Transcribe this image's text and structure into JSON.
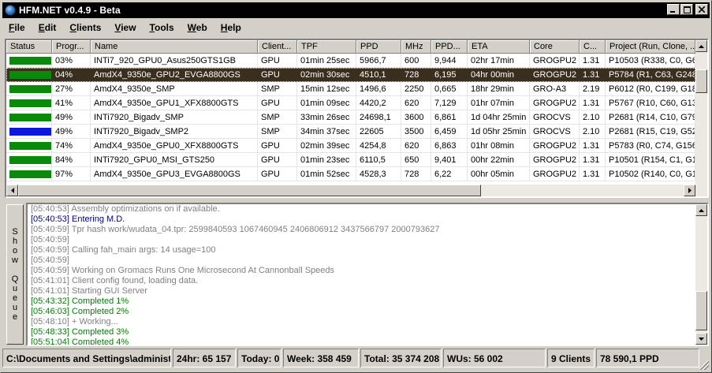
{
  "window": {
    "title": "HFM.NET v0.4.9 - Beta"
  },
  "menu": [
    {
      "first": "F",
      "rest": "ile"
    },
    {
      "first": "E",
      "rest": "dit"
    },
    {
      "first": "C",
      "rest": "lients"
    },
    {
      "first": "V",
      "rest": "iew"
    },
    {
      "first": "T",
      "rest": "ools"
    },
    {
      "first": "W",
      "rest": "eb"
    },
    {
      "first": "H",
      "rest": "elp"
    }
  ],
  "grid": {
    "columns": [
      "Status",
      "Progr...",
      "Name",
      "Client...",
      "TPF",
      "PPD",
      "MHz",
      "PPD...",
      "ETA",
      "Core",
      "C...",
      "Project (Run, Clone, ..."
    ],
    "rows": [
      {
        "status_color": "#0a8a0a",
        "progress": "03%",
        "name": "INTi7_920_GPU0_Asus250GTS1GB",
        "client": "GPU",
        "tpf": "01min 25sec",
        "ppd": "5966,7",
        "mhz": "600",
        "ppd_mhz": "9,944",
        "eta": "02hr 17min",
        "core": "GROGPU2",
        "cv": "1.31",
        "project": "P10503 (R338, C0, G6"
      },
      {
        "status_color": "#0a8a0a",
        "progress": "04%",
        "name": "AmdX4_9350e_GPU2_EVGA8800GS",
        "client": "GPU",
        "tpf": "02min 30sec",
        "ppd": "4510,1",
        "mhz": "728",
        "ppd_mhz": "6,195",
        "eta": "04hr 00min",
        "core": "GROGPU2",
        "cv": "1.31",
        "project": "P5784 (R1, C63, G248",
        "selected": true
      },
      {
        "status_color": "#0a8a0a",
        "progress": "27%",
        "name": "AmdX4_9350e_SMP",
        "client": "SMP",
        "tpf": "15min 12sec",
        "ppd": "1496,6",
        "mhz": "2250",
        "ppd_mhz": "0,665",
        "eta": "18hr 29min",
        "core": "GRO-A3",
        "cv": "2.19",
        "project": "P6012 (R0, C199, G18"
      },
      {
        "status_color": "#0a8a0a",
        "progress": "41%",
        "name": "AmdX4_9350e_GPU1_XFX8800GTS",
        "client": "GPU",
        "tpf": "01min 09sec",
        "ppd": "4420,2",
        "mhz": "620",
        "ppd_mhz": "7,129",
        "eta": "01hr 07min",
        "core": "GROGPU2",
        "cv": "1.31",
        "project": "P5767 (R10, C60, G13"
      },
      {
        "status_color": "#0a8a0a",
        "progress": "49%",
        "name": "INTi7920_Bigadv_SMP",
        "client": "SMP",
        "tpf": "33min 26sec",
        "ppd": "24698,1",
        "mhz": "3600",
        "ppd_mhz": "6,861",
        "eta": "1d 04hr 25min",
        "core": "GROCVS",
        "cv": "2.10",
        "project": "P2681 (R14, C10, G79"
      },
      {
        "status_color": "#0a1ad8",
        "progress": "49%",
        "name": "INTi7920_Bigadv_SMP2",
        "client": "SMP",
        "tpf": "34min 37sec",
        "ppd": "22605",
        "mhz": "3500",
        "ppd_mhz": "6,459",
        "eta": "1d 05hr 25min",
        "core": "GROCVS",
        "cv": "2.10",
        "project": "P2681 (R15, C19, G52"
      },
      {
        "status_color": "#0a8a0a",
        "progress": "74%",
        "name": "AmdX4_9350e_GPU0_XFX8800GTS",
        "client": "GPU",
        "tpf": "02min 39sec",
        "ppd": "4254,8",
        "mhz": "620",
        "ppd_mhz": "6,863",
        "eta": "01hr 08min",
        "core": "GROGPU2",
        "cv": "1.31",
        "project": "P5783 (R0, C74, G156"
      },
      {
        "status_color": "#0a8a0a",
        "progress": "84%",
        "name": "INTi7920_GPU0_MSI_GTS250",
        "client": "GPU",
        "tpf": "01min 23sec",
        "ppd": "6110,5",
        "mhz": "650",
        "ppd_mhz": "9,401",
        "eta": "00hr 22min",
        "core": "GROGPU2",
        "cv": "1.31",
        "project": "P10501 (R154, C1, G1"
      },
      {
        "status_color": "#0a8a0a",
        "progress": "97%",
        "name": "AmdX4_9350e_GPU3_EVGA8800GS",
        "client": "GPU",
        "tpf": "01min 52sec",
        "ppd": "4528,3",
        "mhz": "728",
        "ppd_mhz": "6,22",
        "eta": "00hr 05min",
        "core": "GROGPU2",
        "cv": "1.31",
        "project": "P10502 (R140, C0, G1"
      }
    ]
  },
  "show_queue_label": "Show Queue",
  "log": [
    {
      "t": "[05:40:53] Assembly optimizations on if available.",
      "c": "lg-gray"
    },
    {
      "t": "[05:40:53] Entering M.D.",
      "c": "lg-blue"
    },
    {
      "t": "[05:40:59] Tpr hash work/wudata_04.tpr:  2599840593 1067460945 2406806912 3437566797 2000793627",
      "c": "lg-gray"
    },
    {
      "t": "[05:40:59]",
      "c": "lg-gray"
    },
    {
      "t": "[05:40:59] Calling fah_main args: 14 usage=100",
      "c": "lg-gray"
    },
    {
      "t": "[05:40:59]",
      "c": "lg-gray"
    },
    {
      "t": "[05:40:59] Working on Gromacs Runs One Microsecond At Cannonball Speeds",
      "c": "lg-gray"
    },
    {
      "t": "[05:41:01] Client config found, loading data.",
      "c": "lg-gray"
    },
    {
      "t": "[05:41:01] Starting GUI Server",
      "c": "lg-gray"
    },
    {
      "t": "[05:43:32] Completed 1%",
      "c": "lg-green"
    },
    {
      "t": "[05:46:03] Completed 2%",
      "c": "lg-green"
    },
    {
      "t": "[05:48:10] + Working...",
      "c": "lg-gray"
    },
    {
      "t": "[05:48:33] Completed 3%",
      "c": "lg-green"
    },
    {
      "t": "[05:51:04] Completed 4%",
      "c": "lg-green"
    }
  ],
  "status": {
    "path": "C:\\Documents and Settings\\administ",
    "h24": "24hr: 65 157",
    "today": "Today: 0",
    "week": "Week: 358 459",
    "total": "Total: 35 374 208",
    "wus": "WUs: 56 002",
    "clients": "9 Clients",
    "ppd": "78 590,1 PPD"
  }
}
